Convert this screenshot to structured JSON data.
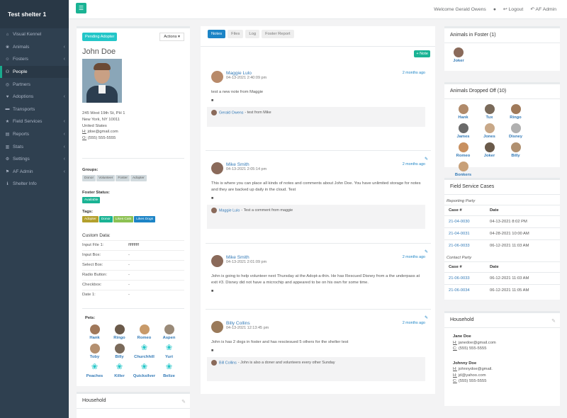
{
  "sidebar": {
    "brand": "Test shelter 1",
    "items": [
      {
        "label": "Visual Kennel",
        "icon": "home-icon",
        "chev": false
      },
      {
        "label": "Animals",
        "icon": "paw-icon",
        "chev": true
      },
      {
        "label": "Fosters",
        "icon": "person-icon",
        "chev": true
      },
      {
        "label": "People",
        "icon": "users-icon",
        "chev": false,
        "active": true
      },
      {
        "label": "Partners",
        "icon": "globe-icon",
        "chev": false
      },
      {
        "label": "Adoptions",
        "icon": "heart-icon",
        "chev": true
      },
      {
        "label": "Transports",
        "icon": "truck-icon",
        "chev": false
      },
      {
        "label": "Field Services",
        "icon": "star-icon",
        "chev": true
      },
      {
        "label": "Reports",
        "icon": "report-icon",
        "chev": true
      },
      {
        "label": "Stats",
        "icon": "stats-icon",
        "chev": true
      },
      {
        "label": "Settings",
        "icon": "gear-icon",
        "chev": true
      },
      {
        "label": "AF Admin",
        "icon": "admin-icon",
        "chev": true
      },
      {
        "label": "Shelter Info",
        "icon": "info-icon",
        "chev": false
      }
    ]
  },
  "topbar": {
    "welcome": "Welcome Gerald Owens",
    "logout": "Logout",
    "admin": "AF Admin"
  },
  "profile": {
    "status_btn": "Pending Adopter",
    "actions": "Actions",
    "name": "John Doe",
    "address": [
      "245 West 19th St, PH 1",
      "New York, NY 10011",
      "United States"
    ],
    "home_label": "H:",
    "email": "jdoe@gmail.com",
    "phone_label": "O:",
    "phone": "(555) 555-5555",
    "groups_label": "Groups:",
    "groups": [
      "Donor",
      "Volunteer",
      "Foster",
      "Adopter"
    ],
    "foster_status_label": "Foster Status:",
    "foster_status": "Available",
    "tags_label": "Tags:",
    "tags": [
      {
        "text": "Adopter",
        "color": "#b3a02c"
      },
      {
        "text": "Donor",
        "color": "#1ab394"
      },
      {
        "text": "Likes Cats",
        "color": "#8cc152"
      },
      {
        "text": "Likes Dogs",
        "color": "#1c84c6"
      }
    ],
    "custom_label": "Custom Data:",
    "custom": [
      {
        "k": "Input File 1:",
        "v": "ffffffffff"
      },
      {
        "k": "Input Box:",
        "v": "-"
      },
      {
        "k": "Select Box:",
        "v": "-"
      },
      {
        "k": "Radio Button:",
        "v": "-"
      },
      {
        "k": "Checkbox:",
        "v": "-"
      },
      {
        "k": "Date 1:",
        "v": "-"
      }
    ],
    "pets_label": "Pets:",
    "pets": [
      {
        "n": "Hank",
        "p": false
      },
      {
        "n": "Ringo",
        "p": false
      },
      {
        "n": "Romeo",
        "p": false
      },
      {
        "n": "Aspen",
        "p": false
      },
      {
        "n": "Toby",
        "p": false
      },
      {
        "n": "Billy",
        "p": false
      },
      {
        "n": "Churchhill",
        "p": true
      },
      {
        "n": "Yuri",
        "p": true
      },
      {
        "n": "Peaches",
        "p": true
      },
      {
        "n": "Killer",
        "p": true
      },
      {
        "n": "Quicksilver",
        "p": true
      },
      {
        "n": "Belize",
        "p": true
      }
    ],
    "household_title": "Household"
  },
  "tabs": [
    "Notes",
    "Files",
    "Log",
    "Foster Report"
  ],
  "add_note": "+ Note",
  "notes": [
    {
      "author": "Maggie Lulo",
      "date": "04-13-2021 2:40:09 pm",
      "ago": "2 months ago",
      "body": "test a new note from Maggie",
      "reply_author": "Gerald Owens",
      "reply_text": "- test from Mike"
    },
    {
      "author": "Mike Smith",
      "date": "04-13-2021 2:05:14 pm",
      "ago": "2 months ago",
      "body": "This is where you can place all kinds of notes and comments about John Doe. You have unlimited storage for notes and they are backed up daily in the cloud. Test",
      "reply_author": "Maggie Lulo",
      "reply_text": "- Test a comment from maggie"
    },
    {
      "author": "Mike Smith",
      "date": "04-13-2021 2:01:09 pm",
      "ago": "2 months ago",
      "body": "John is going to help volunteer next Thursday at the Adopt-a-thin. He has Rescued Disney from a the underpass at exit #3. Disney did not have a microchip and appeared to be on his own for some time."
    },
    {
      "author": "Billy Collins",
      "date": "04-13-2021 12:13:45 pm",
      "ago": "2 months ago",
      "body": "John is has 2 dogs in foster and has resctesued 5 others for the shelter test",
      "reply_author": "Bill Collins",
      "reply_text": "- John is also a doner and volunteers every other Sunday"
    }
  ],
  "foster": {
    "title": "Animals in Foster (1)",
    "animals": [
      "Joker"
    ]
  },
  "dropped": {
    "title": "Animals Dropped Off (10)",
    "animals": [
      "Hank",
      "Tux",
      "Ringo",
      "James",
      "Jones",
      "Disney",
      "Romeo",
      "Joker",
      "Billy",
      "Bonkers"
    ]
  },
  "cases": {
    "title": "Field Service Cases",
    "reporting_label": "Reporting Party",
    "contact_label": "Contact Party",
    "col1": "Case #",
    "col2": "Date",
    "reporting": [
      {
        "c": "21-04-0030",
        "d": "04-13-2021 8:02 PM"
      },
      {
        "c": "21-04-0031",
        "d": "04-28-2021 10:00 AM"
      },
      {
        "c": "21-06-0033",
        "d": "06-12-2021 11:03 AM"
      }
    ],
    "contact": [
      {
        "c": "21-06-0033",
        "d": "06-12-2021 11:03 AM"
      },
      {
        "c": "21-06-0034",
        "d": "06-12-2021 11:05 AM"
      }
    ]
  },
  "household": {
    "title": "Household",
    "members": [
      {
        "name": "Jane Doe",
        "email": "janedoe@gmail.com",
        "phone": "(555) 555-5555"
      },
      {
        "name": "Johnny Doe",
        "email": "johnnydoe@gmail.",
        "email2": "jd@yahoo.com",
        "phone": "(555) 555-5555"
      }
    ],
    "h_label": "H:",
    "c_label": "C:"
  }
}
